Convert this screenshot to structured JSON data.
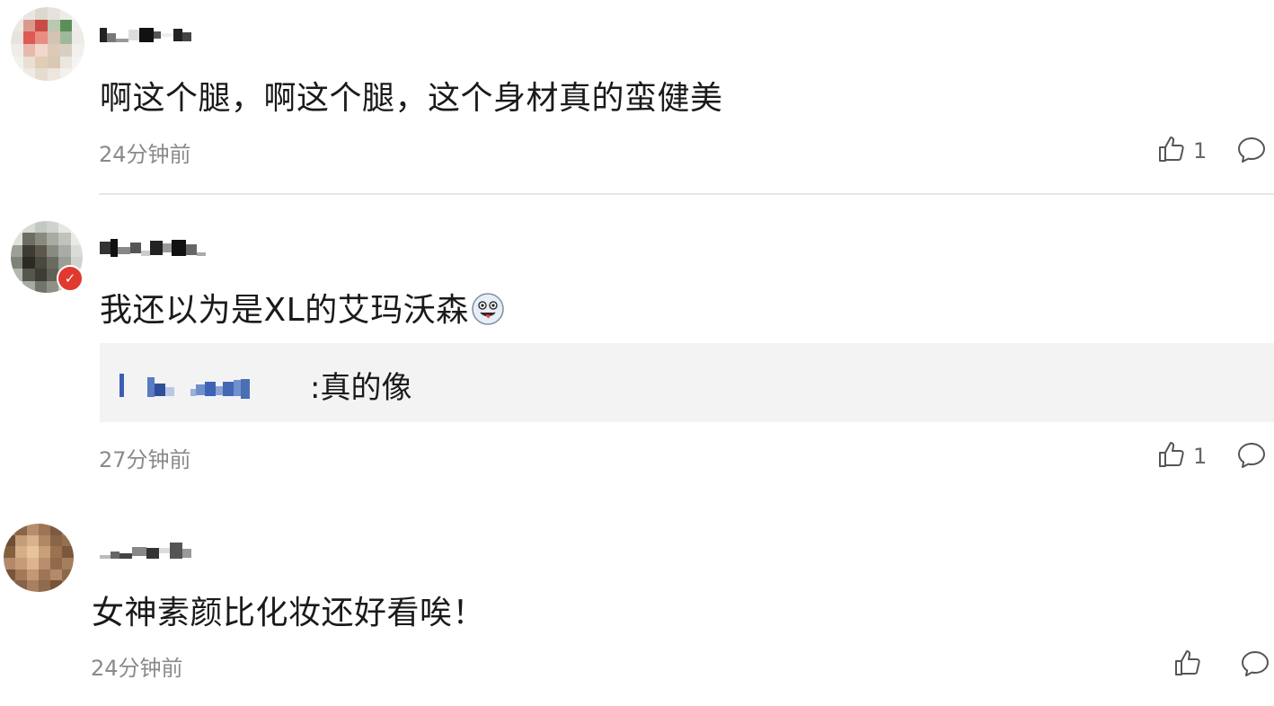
{
  "comments": [
    {
      "text": "啊这个腿，啊这个腿，这个身材真的蛮健美",
      "time": "24分钟前",
      "likes": "1"
    },
    {
      "text": "我还以为是XL的艾玛沃森",
      "emoji": "laughing-tongue-emoji",
      "reply": {
        "text": ":真的像"
      },
      "time": "27分钟前",
      "likes": "1"
    },
    {
      "text": "女神素颜比化妆还好看唉！",
      "time": "24分钟前",
      "likes": ""
    }
  ],
  "icons": {
    "like": "thumbs-up-outline-icon",
    "reply": "speech-bubble-outline-icon"
  },
  "colors": {
    "badge": "#e03a2f",
    "link": "#4a6fb5",
    "meta": "#8a8a8a"
  }
}
